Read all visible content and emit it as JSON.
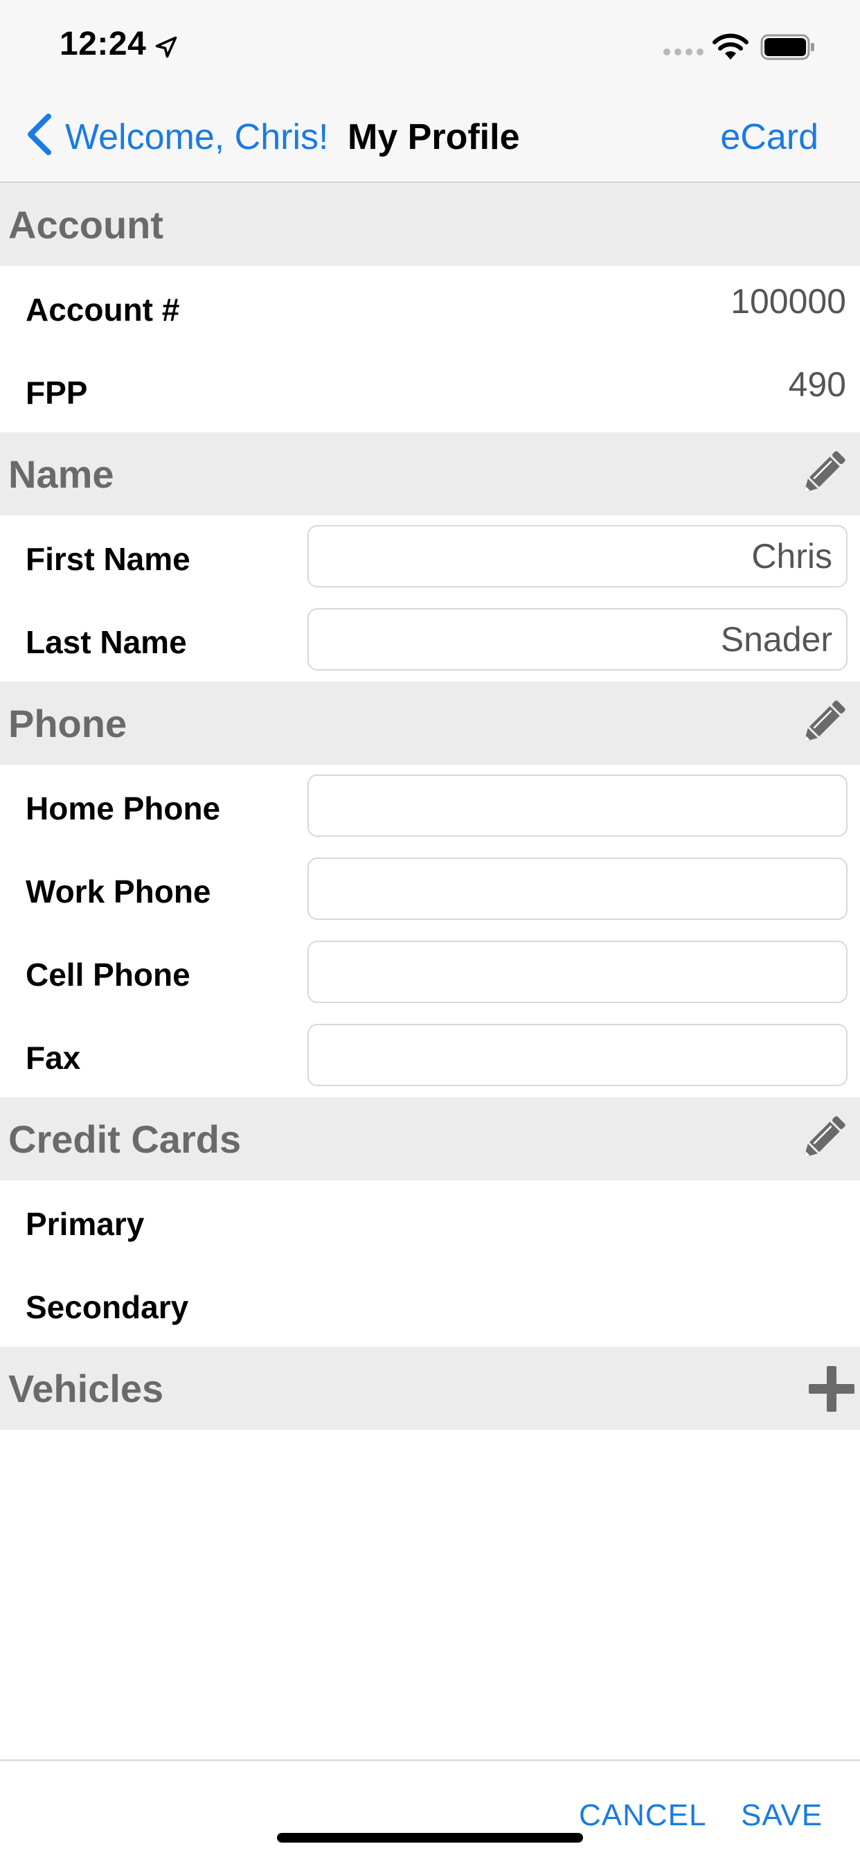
{
  "status_bar": {
    "time": "12:24",
    "icons": [
      "location-arrow-icon",
      "cellular-signal-icon",
      "wifi-icon",
      "battery-icon"
    ]
  },
  "nav": {
    "back_label": "Welcome, Chris!",
    "title": "My Profile",
    "right_label": "eCard",
    "accent_color": "#1a7be0"
  },
  "account": {
    "title": "Account",
    "rows": [
      {
        "label": "Account #",
        "value": "100000"
      },
      {
        "label": "FPP",
        "value": "490"
      }
    ]
  },
  "name": {
    "title": "Name",
    "action_icon": "pencil-icon",
    "first_name": {
      "label": "First Name",
      "value": "Chris"
    },
    "last_name": {
      "label": "Last Name",
      "value": "Snader"
    }
  },
  "phone": {
    "title": "Phone",
    "action_icon": "pencil-icon",
    "home": {
      "label": "Home Phone",
      "value": ""
    },
    "work": {
      "label": "Work Phone",
      "value": ""
    },
    "cell": {
      "label": "Cell Phone",
      "value": ""
    },
    "fax": {
      "label": "Fax",
      "value": ""
    }
  },
  "credit_cards": {
    "title": "Credit Cards",
    "action_icon": "pencil-icon",
    "rows": [
      {
        "label": "Primary",
        "value": ""
      },
      {
        "label": "Secondary",
        "value": ""
      }
    ]
  },
  "vehicles": {
    "title": "Vehicles",
    "action_icon": "plus-icon"
  },
  "footer": {
    "cancel_label": "CANCEL",
    "save_label": "SAVE"
  },
  "colors": {
    "section_header_bg": "#ececec",
    "section_header_text": "#6a6a6a"
  }
}
